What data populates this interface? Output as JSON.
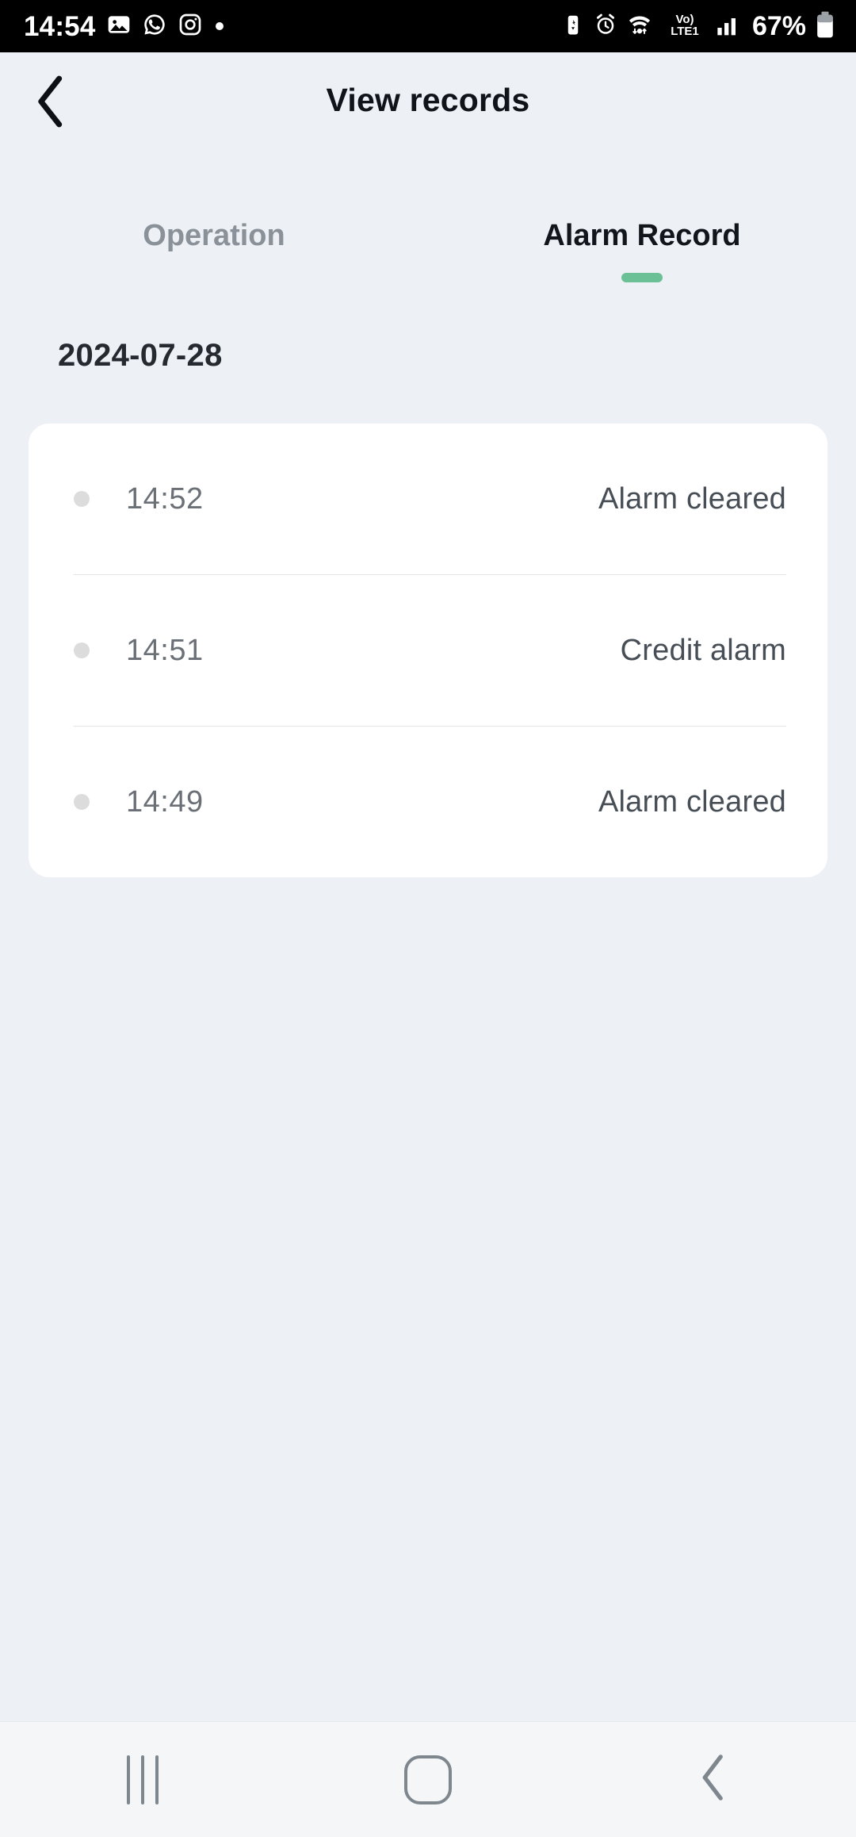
{
  "status_bar": {
    "clock": "14:54",
    "battery_percent": "67%",
    "network": "LTE1",
    "volte": "Vo)",
    "left_icons": [
      "photos-icon",
      "whatsapp-icon",
      "instagram-icon",
      "dot-indicator-icon"
    ],
    "right_icons": [
      "battery-saver-icon",
      "alarm-icon",
      "wifi-icon",
      "volte-lte-icon",
      "signal-bars-icon",
      "battery-icon"
    ]
  },
  "header": {
    "back_icon": "chevron-left-icon",
    "title": "View records"
  },
  "tabs": [
    {
      "label": "Operation",
      "active": false
    },
    {
      "label": "Alarm Record",
      "active": true
    }
  ],
  "records": {
    "date": "2024-07-28",
    "items": [
      {
        "time": "14:52",
        "label": "Alarm cleared"
      },
      {
        "time": "14:51",
        "label": "Credit alarm"
      },
      {
        "time": "14:49",
        "label": "Alarm cleared"
      }
    ]
  },
  "nav_bar": {
    "recents_label": "recents-icon",
    "home_label": "home-icon",
    "back_label": "back-icon"
  },
  "colors": {
    "background": "#EDF1F6",
    "card": "#FFFFFF",
    "accent_green": "#6CC095",
    "title": "#10141A",
    "tab_inactive": "#8A9199",
    "record_time": "#6B7077",
    "record_label": "#474E56",
    "dot": "#DCDCDC",
    "divider": "#E3E6E9",
    "navbar": "#F4F6F8"
  }
}
